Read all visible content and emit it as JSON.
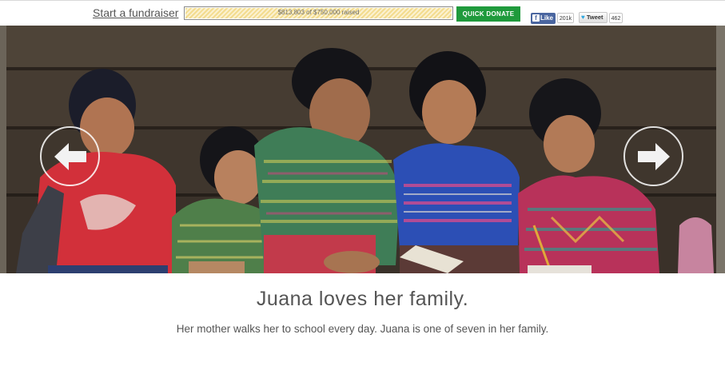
{
  "topbar": {
    "fundraiser_link": "Start a fundraiser",
    "progress": {
      "text": "$813,803 of $750,000 raised",
      "fraction": 1.0
    },
    "donate_label": "QUICK DONATE",
    "facebook": {
      "label": "Like",
      "count": "201k"
    },
    "twitter": {
      "label": "Tweet",
      "count": "462"
    }
  },
  "hero": {
    "image": "photo-of-family-sitting-against-wooden-wall",
    "prev_icon": "arrow-left-icon",
    "next_icon": "arrow-right-icon"
  },
  "story": {
    "title": "Juana loves her family.",
    "text": "Her mother walks her to school every day. Juana is one of seven in her family."
  },
  "colors": {
    "donate": "#1f9a3c",
    "facebook": "#4a66a0",
    "progress_fill": "#f3dc8f"
  }
}
